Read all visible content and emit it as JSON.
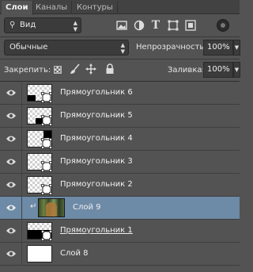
{
  "tabs": [
    "Слои",
    "Каналы",
    "Контуры"
  ],
  "filter": {
    "kind": "Вид"
  },
  "blend": {
    "mode": "Обычные",
    "opacity_label": "Непрозрачность:",
    "opacity": "100%"
  },
  "lock": {
    "label": "Закрепить:",
    "fill_label": "Заливка:",
    "fill": "100%"
  },
  "layers": [
    {
      "name": "Прямоугольник 6",
      "visible": true
    },
    {
      "name": "Прямоугольник 5",
      "visible": true
    },
    {
      "name": "Прямоугольник 4",
      "visible": true
    },
    {
      "name": "Прямоугольник 3",
      "visible": true
    },
    {
      "name": "Прямоугольник 2",
      "visible": true
    },
    {
      "name": "Слой 9",
      "visible": true,
      "selected": true,
      "clipped": true
    },
    {
      "name": "Прямоугольник 1",
      "visible": true
    },
    {
      "name": "Слой 8",
      "visible": true
    }
  ],
  "colors": {
    "panel": "#535353",
    "selection": "#6d8aa6",
    "tabbar": "#424242"
  }
}
